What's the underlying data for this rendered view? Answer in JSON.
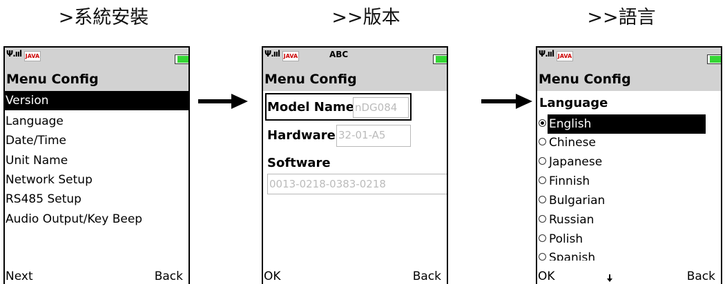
{
  "captions": [
    ">系統安裝",
    ">>版本",
    ">>語言"
  ],
  "colors": {
    "bar_bg": "#d2d2d2",
    "battery": "#35d635",
    "java_logo": "#cc0000",
    "selection": "#000000",
    "field_text": "#bbbbbb"
  },
  "icons": [
    "signal-strength-icon",
    "java-icon",
    "battery-icon",
    "arrow-right-icon",
    "scroll-down-icon",
    "radio-icon"
  ],
  "screen1": {
    "status": {
      "java_label": "JAVA"
    },
    "title": "Menu Config",
    "items": [
      "Version",
      "Language",
      "Date/Time",
      "Unit Name",
      "Network Setup",
      "RS485 Setup",
      "Audio Output/Key Beep"
    ],
    "selected_index": 0,
    "left_softkey": "Next",
    "right_softkey": "Back"
  },
  "screen2": {
    "status": {
      "java_label": "JAVA",
      "input_mode": "ABC"
    },
    "title": "Menu Config",
    "model_label": "Model Name",
    "model_value": "nDG084",
    "hardware_label": "Hardware",
    "hardware_value": "32-01-A5",
    "software_label": "Software",
    "software_value": "0013-0218-0383-0218",
    "left_softkey": "OK",
    "right_softkey": "Back"
  },
  "screen3": {
    "status": {
      "java_label": "JAVA"
    },
    "title": "Menu Config",
    "group_label": "Language",
    "options": [
      "English",
      "Chinese",
      "Japanese",
      "Finnish",
      "Bulgarian",
      "Russian",
      "Polish",
      "Spanish"
    ],
    "selected_index": 0,
    "left_softkey": "OK",
    "right_softkey": "Back"
  }
}
